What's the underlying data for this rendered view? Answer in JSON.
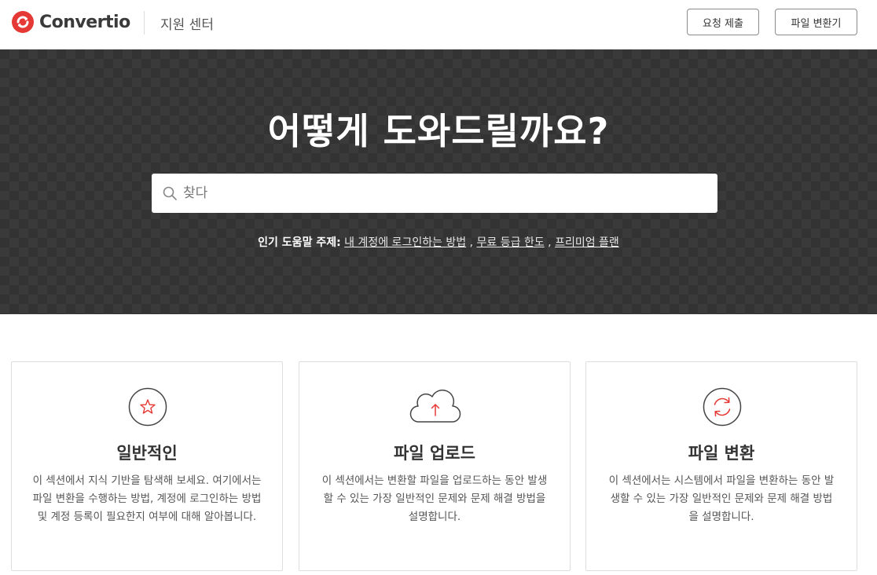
{
  "header": {
    "logo_text": "Convertio",
    "support_title": "지원 센터",
    "request_button": "요청 제출",
    "convert_button": "파일 변환기"
  },
  "hero": {
    "title": "어떻게 도와드릴까요?",
    "search_placeholder": "찾다",
    "popular_label": "인기 도움말 주제:",
    "popular_links": [
      "내 계정에 로그인하는 방법",
      "무료 등급 한도",
      "프리미엄 플랜"
    ],
    "separator": ","
  },
  "cards": [
    {
      "icon": "star-icon",
      "title": "일반적인",
      "description": "이 섹션에서 지식 기반을 탐색해 보세요. 여기에서는 파일 변환을 수행하는 방법, 계정에 로그인하는 방법 및 계정 등록이 필요한지 여부에 대해 알아봅니다."
    },
    {
      "icon": "cloud-upload-icon",
      "title": "파일 업로드",
      "description": "이 섹션에서는 변환할 파일을 업로드하는 동안 발생할 수 있는 가장 일반적인 문제와 문제 해결 방법을 설명합니다."
    },
    {
      "icon": "convert-arrows-icon",
      "title": "파일 변환",
      "description": "이 섹션에서는 시스템에서 파일을 변환하는 동안 발생할 수 있는 가장 일반적인 문제와 문제 해결 방법을 설명합니다."
    }
  ],
  "colors": {
    "brand_red": "#e53935",
    "hero_bg": "#333333",
    "text_dark": "#333333"
  }
}
